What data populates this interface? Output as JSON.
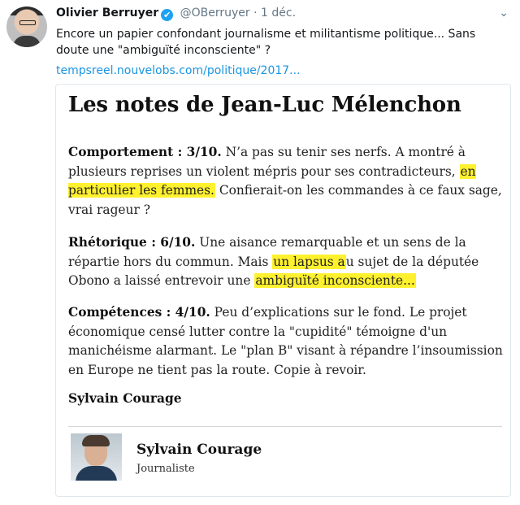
{
  "tweet": {
    "author_name": "Olivier Berruyer",
    "verified_icon": "✔",
    "handle": "@OBerruyer",
    "separator": "·",
    "date": "1 déc.",
    "menu_icon": "⌄",
    "text": "Encore un papier confondant journalisme et militantisme politique... Sans doute une \"ambiguïté inconsciente\" ?",
    "link": "tempsreel.nouvelobs.com/politique/2017..."
  },
  "article": {
    "title": "Les notes de Jean-Luc Mélenchon",
    "paragraphs": [
      {
        "label": "Comportement : 3/10.",
        "before": " N’a pas su tenir ses nerfs. A montré à plusieurs reprises un violent mépris pour ses contradicteurs, ",
        "highlight": "en particulier les femmes.",
        "after": " Confierait-on les commandes à ce faux sage, vrai rageur ?"
      },
      {
        "label": "Rhétorique : 6/10.",
        "before": " Une aisance remarquable et un sens de la répartie hors du commun. Mais ",
        "highlight": "un lapsus a",
        "middle": "u sujet de la députée Obono a laissé entrevoir une ",
        "highlight2": "ambiguïté inconsciente...",
        "after": ""
      },
      {
        "label": "Compétences : 4/10.",
        "before": " Peu d’explications sur le fond. Le projet économique censé lutter contre la \"cupidité\" témoigne d'un manichéisme alarmant. Le \"plan B\" visant à répandre l’insoumission en Europe ne tient pas la route. Copie à revoir.",
        "highlight": "",
        "after": ""
      }
    ],
    "signature": "Sylvain Courage",
    "author": {
      "name": "Sylvain Courage",
      "role": "Journaliste"
    }
  }
}
